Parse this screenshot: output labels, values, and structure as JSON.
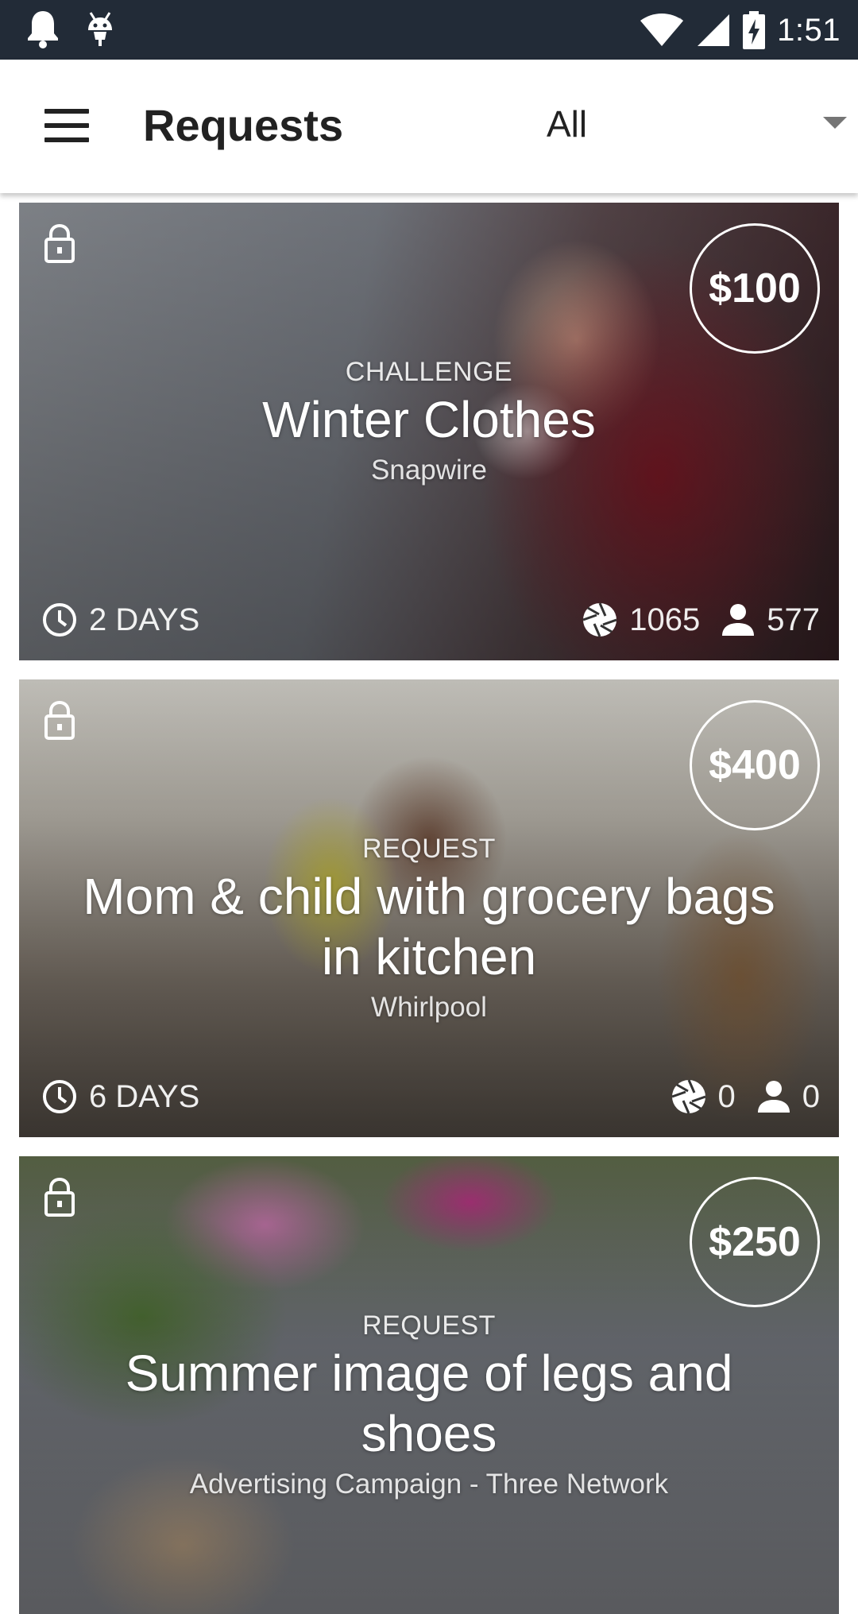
{
  "status_bar": {
    "time": "1:51",
    "left_icons": [
      "notification-bell-icon",
      "android-debug-icon"
    ],
    "right_icons": [
      "wifi-icon",
      "cell-signal-icon",
      "battery-charging-icon"
    ]
  },
  "app_bar": {
    "menu_icon": "hamburger-menu-icon",
    "title": "Requests",
    "filter": {
      "selected": "All",
      "icon": "dropdown-arrow-icon"
    }
  },
  "cards": [
    {
      "type": "CHALLENGE",
      "title": "Winter Clothes",
      "organization": "Snapwire",
      "price": "$100",
      "deadline": "2 DAYS",
      "photos": "1065",
      "contributors": "577",
      "locked": true
    },
    {
      "type": "REQUEST",
      "title": "Mom & child with grocery bags in kitchen",
      "organization": "Whirlpool",
      "price": "$400",
      "deadline": "6 DAYS",
      "photos": "0",
      "contributors": "0",
      "locked": true
    },
    {
      "type": "REQUEST",
      "title": "Summer image of legs and shoes",
      "organization": "Advertising Campaign - Three Network",
      "price": "$250",
      "locked": true
    }
  ],
  "colors": {
    "status_bar": "#222b37",
    "app_bar": "#ffffff",
    "title_text": "#222222"
  }
}
